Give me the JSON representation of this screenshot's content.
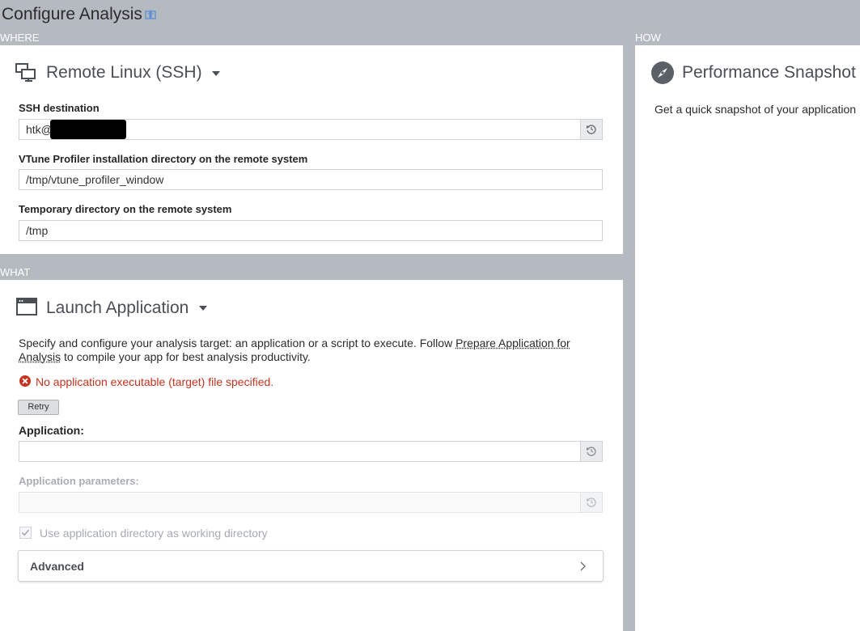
{
  "header": {
    "title": "Configure Analysis"
  },
  "where": {
    "section_label": "WHERE",
    "target": "Remote Linux (SSH)",
    "ssh_label": "SSH destination",
    "ssh_value": "htk@",
    "install_dir_label": "VTune Profiler installation directory on the remote system",
    "install_dir_value": "/tmp/vtune_profiler_window",
    "temp_dir_label": "Temporary directory on the remote system",
    "temp_dir_value": "/tmp"
  },
  "what": {
    "section_label": "WHAT",
    "target": "Launch Application",
    "desc_before": "Specify and configure your analysis target: an application or a script to execute. Follow ",
    "desc_link": "Prepare Application for Analysis",
    "desc_after": " to compile your app for best analysis productivity.",
    "error": "No application executable (target) file specified.",
    "retry_label": "Retry",
    "app_label": "Application:",
    "app_value": "",
    "params_label": "Application parameters:",
    "params_value": "",
    "workdir_label": "Use application directory as working directory",
    "workdir_checked": true,
    "advanced_label": "Advanced"
  },
  "how": {
    "section_label": "HOW",
    "analysis": "Performance Snapshot",
    "description": "Get a quick snapshot of your application"
  },
  "colors": {
    "background": "#b5bac0",
    "panel": "#ffffff",
    "error": "#c4331e",
    "info_icon": "#5b8fd6",
    "compass": "#5a6066"
  }
}
